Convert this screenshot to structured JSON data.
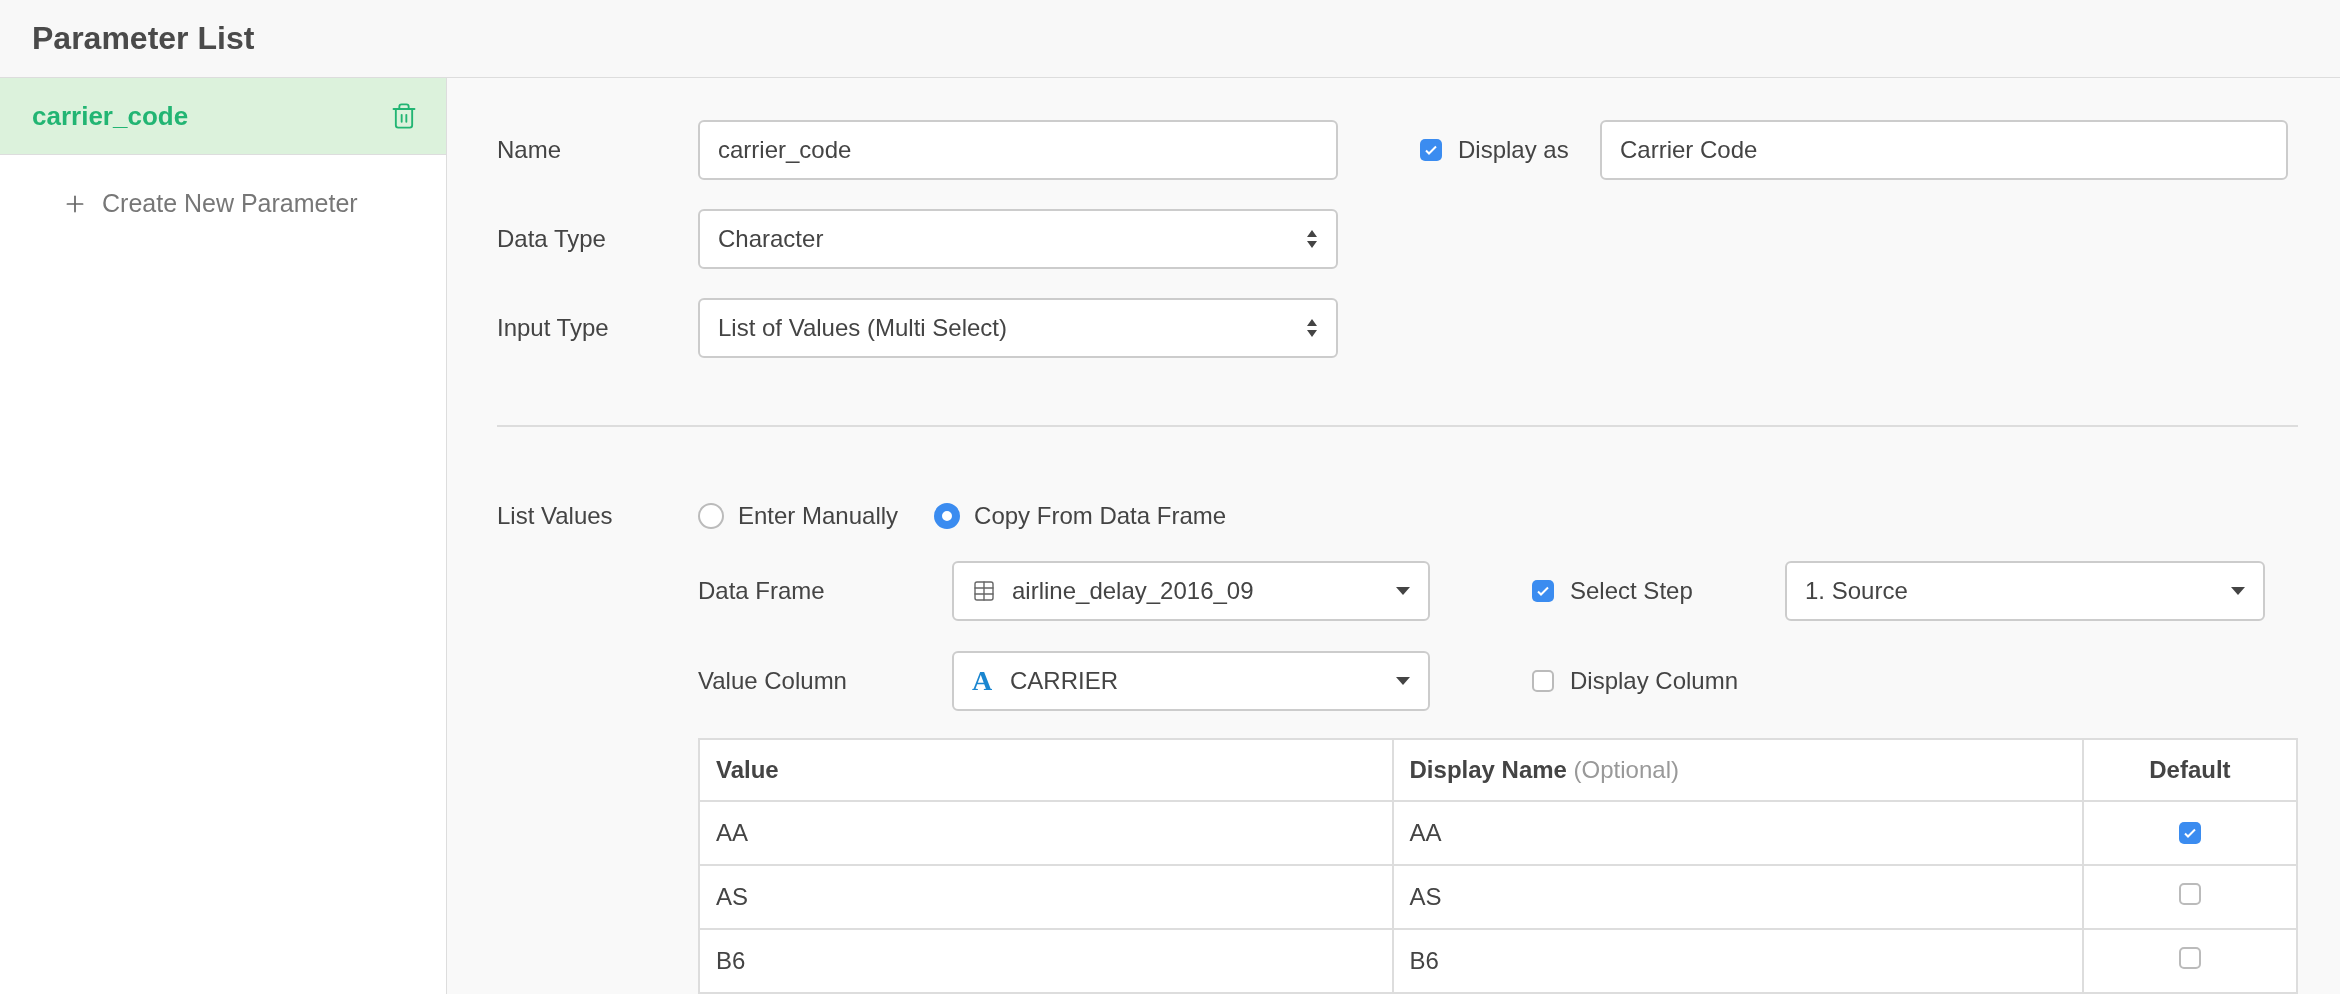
{
  "header": {
    "title": "Parameter List"
  },
  "sidebar": {
    "items": [
      {
        "label": "carrier_code",
        "selected": true
      }
    ],
    "create_label": "Create New Parameter"
  },
  "form": {
    "name": {
      "label": "Name",
      "value": "carrier_code"
    },
    "display_as": {
      "label": "Display as",
      "checked": true,
      "value": "Carrier Code"
    },
    "data_type": {
      "label": "Data Type",
      "value": "Character"
    },
    "input_type": {
      "label": "Input Type",
      "value": "List of Values (Multi Select)"
    }
  },
  "list_values": {
    "label": "List Values",
    "options": [
      {
        "label": "Enter Manually",
        "selected": false
      },
      {
        "label": "Copy From Data Frame",
        "selected": true
      }
    ],
    "data_frame": {
      "label": "Data Frame",
      "value": "airline_delay_2016_09"
    },
    "select_step": {
      "label": "Select Step",
      "checked": true,
      "value": "1. Source"
    },
    "value_column": {
      "label": "Value Column",
      "type_glyph": "A",
      "value": "CARRIER"
    },
    "display_column": {
      "label": "Display Column",
      "checked": false
    }
  },
  "table": {
    "columns": [
      {
        "label": "Value"
      },
      {
        "label": "Display Name",
        "hint": "(Optional)"
      },
      {
        "label": "Default"
      }
    ],
    "rows": [
      {
        "value": "AA",
        "display_name": "AA",
        "default": true
      },
      {
        "value": "AS",
        "display_name": "AS",
        "default": false
      },
      {
        "value": "B6",
        "display_name": "B6",
        "default": false
      }
    ]
  }
}
